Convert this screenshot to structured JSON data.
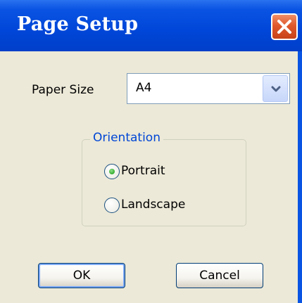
{
  "window": {
    "title": "Page Setup",
    "close_icon": "close-icon",
    "accent_color": "#0a54e3",
    "close_color": "#e0582c"
  },
  "paper_size": {
    "label": "Paper Size",
    "selected_value": "A4",
    "dropdown_icon": "chevron-down-icon"
  },
  "orientation": {
    "legend": "Orientation",
    "options": [
      {
        "label": "Portrait",
        "selected": true
      },
      {
        "label": "Landscape",
        "selected": false
      }
    ]
  },
  "buttons": {
    "ok_label": "OK",
    "cancel_label": "Cancel"
  }
}
